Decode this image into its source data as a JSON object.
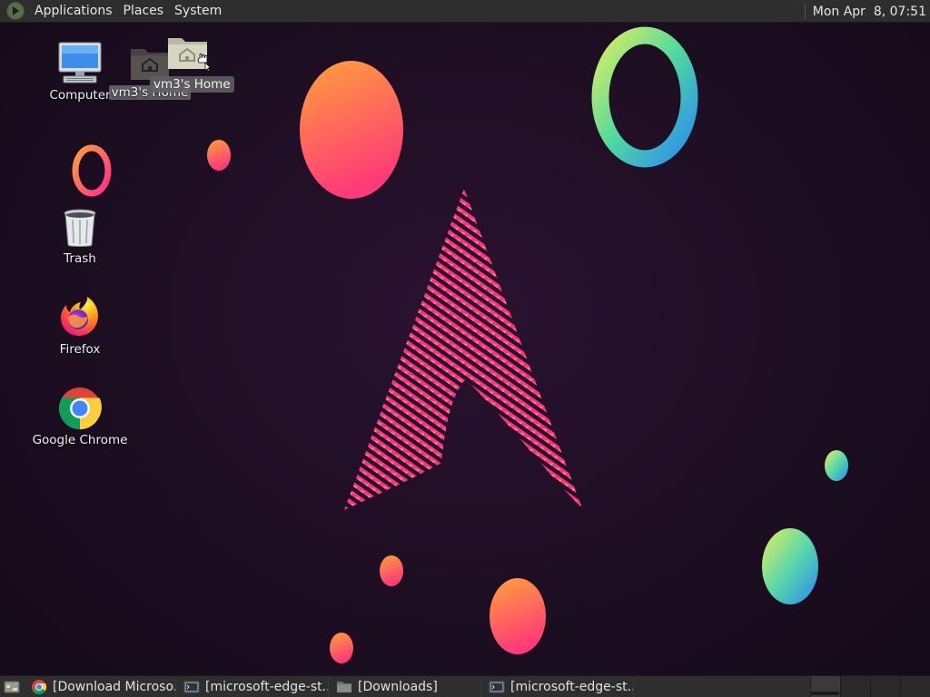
{
  "top_panel": {
    "menus": [
      "Applications",
      "Places",
      "System"
    ],
    "clock": "Mon Apr  8, 07:51"
  },
  "desktop": {
    "icons": {
      "computer": "Computer",
      "home": "vm3's Home",
      "trash": "Trash",
      "firefox": "Firefox",
      "chrome": "Google Chrome"
    },
    "drag_label": "vm3's Home"
  },
  "taskbar": {
    "tasks": [
      {
        "label": "[Download Microso...",
        "icon": "chrome-icon"
      },
      {
        "label": "[microsoft-edge-st...",
        "icon": "terminal-icon"
      },
      {
        "label": "[Downloads]",
        "icon": "folder-icon"
      },
      {
        "label": "[microsoft-edge-st...",
        "icon": "terminal-icon"
      }
    ],
    "workspaces": 4
  },
  "colors": {
    "panel": "#2e2e2e",
    "wallpaper_bg": "#1d0e22",
    "accent_pink": "#ff2d8a",
    "accent_orange": "#ff9e3d"
  }
}
